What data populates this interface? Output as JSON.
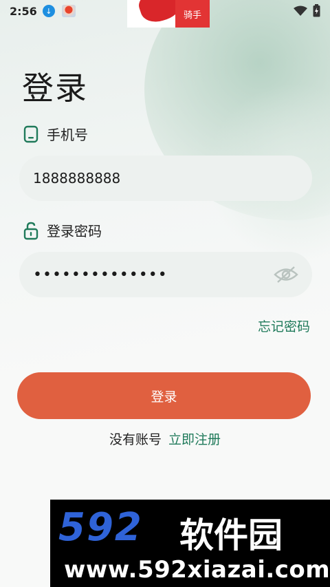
{
  "status_bar": {
    "time": "2:56"
  },
  "top_logo": {
    "tag_text": "骑手"
  },
  "page": {
    "title": "登录"
  },
  "phone": {
    "label": "手机号",
    "value": "1888888888"
  },
  "password": {
    "label": "登录密码",
    "masked_value": "••••••••••••••"
  },
  "links": {
    "forgot": "忘记密码",
    "no_account": "没有账号",
    "register": "立即注册"
  },
  "login_button": {
    "label": "登录"
  },
  "watermark": {
    "brand": "592",
    "brand_cn": "软件园",
    "url": "www.592xiazai.com"
  },
  "colors": {
    "accent_green": "#1f7a5a",
    "button_orange": "#e06040",
    "input_bg": "#edf1ef"
  }
}
